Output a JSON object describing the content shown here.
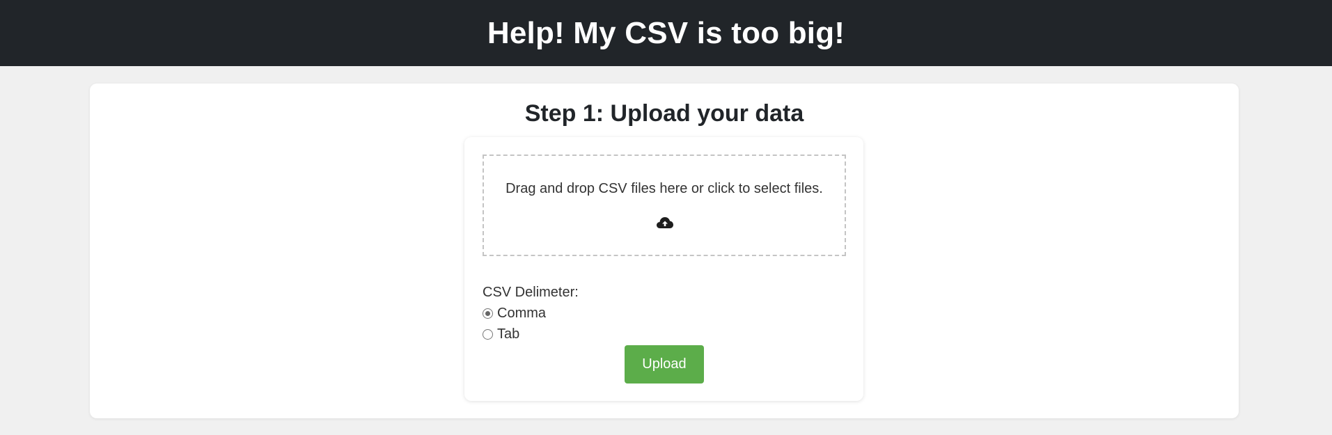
{
  "header": {
    "title": "Help! My CSV is too big!"
  },
  "step": {
    "title": "Step 1: Upload your data"
  },
  "dropzone": {
    "text": "Drag and drop CSV files here or click to select files.",
    "icon": "cloud-upload-icon"
  },
  "delimiter": {
    "label": "CSV Delimeter:",
    "options": [
      {
        "label": "Comma",
        "checked": true
      },
      {
        "label": "Tab",
        "checked": false
      }
    ]
  },
  "upload": {
    "label": "Upload",
    "color": "#5cad4a"
  },
  "colors": {
    "header_bg": "#212529",
    "page_bg": "#f0f0f0"
  }
}
